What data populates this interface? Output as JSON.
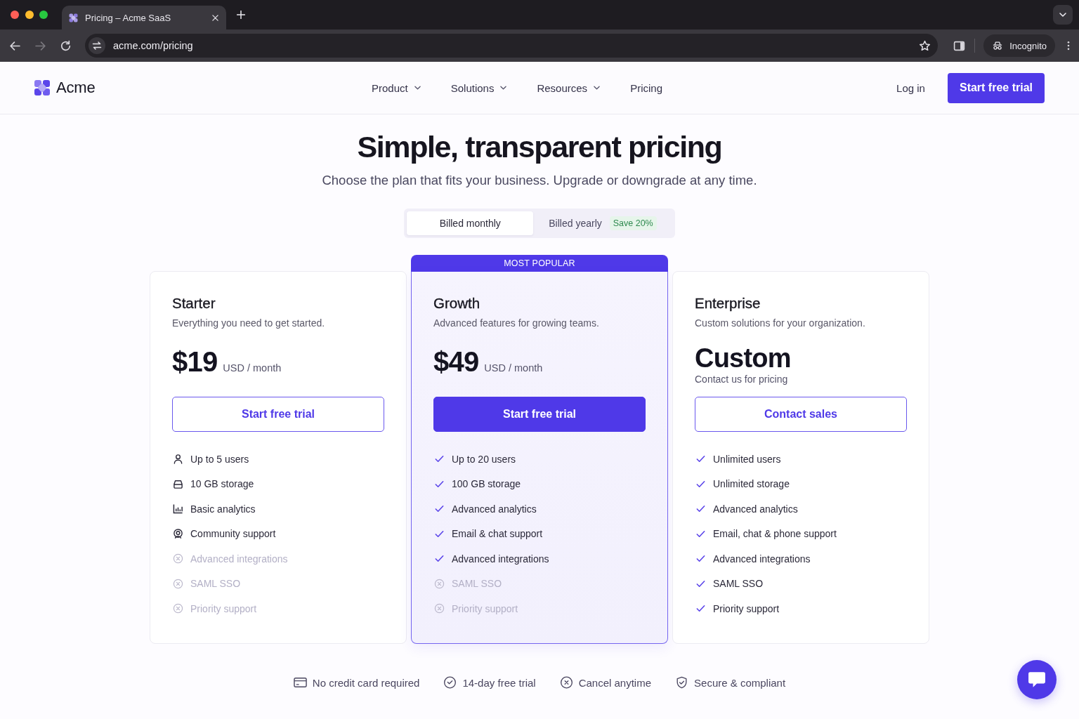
{
  "browser": {
    "tab_title": "Pricing – Acme SaaS",
    "url": "acme.com/pricing",
    "forward_disabled": true,
    "profile_label": "Incognito"
  },
  "header": {
    "logo": "Acme",
    "nav": [
      {
        "label": "Product",
        "dropdown": true
      },
      {
        "label": "Solutions",
        "dropdown": true
      },
      {
        "label": "Resources",
        "dropdown": true
      },
      {
        "label": "Pricing",
        "dropdown": false
      }
    ],
    "login": "Log in",
    "cta": "Start free trial"
  },
  "hero": {
    "title": "Simple, transparent pricing",
    "subtitle": "Choose the plan that fits your business. Upgrade or downgrade at any time."
  },
  "billing": {
    "options": [
      {
        "label": "Billed monthly",
        "selected": true
      },
      {
        "label": "Billed yearly",
        "selected": false,
        "badge": "Save 20%"
      }
    ]
  },
  "plans": [
    {
      "name": "Starter",
      "description": "Everything you need to get started.",
      "price": "$19",
      "unit": "USD / month",
      "highlighted": false,
      "button": {
        "label": "Start free trial",
        "primary": false
      },
      "features": [
        {
          "kind": "user",
          "text": "Up to 5 users",
          "included": true
        },
        {
          "kind": "storage",
          "text": "10 GB storage",
          "included": true
        },
        {
          "kind": "chart",
          "text": "Basic analytics",
          "included": true
        },
        {
          "kind": "support",
          "text": "Community support",
          "included": true
        },
        {
          "kind": "cross",
          "text": "Advanced integrations",
          "included": false
        },
        {
          "kind": "cross",
          "text": "SAML SSO",
          "included": false
        },
        {
          "kind": "cross",
          "text": "Priority support",
          "included": false
        }
      ]
    },
    {
      "name": "Growth",
      "badge": "MOST POPULAR",
      "description": "Advanced features for growing teams.",
      "price": "$49",
      "unit": "USD / month",
      "highlighted": true,
      "button": {
        "label": "Start free trial",
        "primary": true
      },
      "features": [
        {
          "kind": "check",
          "text": "Up to 20 users",
          "included": true
        },
        {
          "kind": "check",
          "text": "100 GB storage",
          "included": true
        },
        {
          "kind": "check",
          "text": "Advanced analytics",
          "included": true
        },
        {
          "kind": "check",
          "text": "Email & chat support",
          "included": true
        },
        {
          "kind": "check",
          "text": "Advanced integrations",
          "included": true
        },
        {
          "kind": "cross",
          "text": "SAML SSO",
          "included": false
        },
        {
          "kind": "cross",
          "text": "Priority support",
          "included": false
        }
      ]
    },
    {
      "name": "Enterprise",
      "description": "Custom solutions for your organization.",
      "price": "Custom",
      "note": "Contact us for pricing",
      "highlighted": false,
      "button": {
        "label": "Contact sales",
        "primary": false
      },
      "features": [
        {
          "kind": "check",
          "text": "Unlimited users",
          "included": true
        },
        {
          "kind": "check",
          "text": "Unlimited storage",
          "included": true
        },
        {
          "kind": "check",
          "text": "Advanced analytics",
          "included": true
        },
        {
          "kind": "check",
          "text": "Email, chat & phone support",
          "included": true
        },
        {
          "kind": "check",
          "text": "Advanced integrations",
          "included": true
        },
        {
          "kind": "check",
          "text": "SAML SSO",
          "included": true
        },
        {
          "kind": "check",
          "text": "Priority support",
          "included": true
        }
      ]
    }
  ],
  "perks": [
    {
      "kind": "card",
      "text": "No credit card required"
    },
    {
      "kind": "check",
      "text": "14-day free trial"
    },
    {
      "kind": "cancel",
      "text": "Cancel anytime"
    },
    {
      "kind": "shield",
      "text": "Secure & compliant"
    }
  ]
}
